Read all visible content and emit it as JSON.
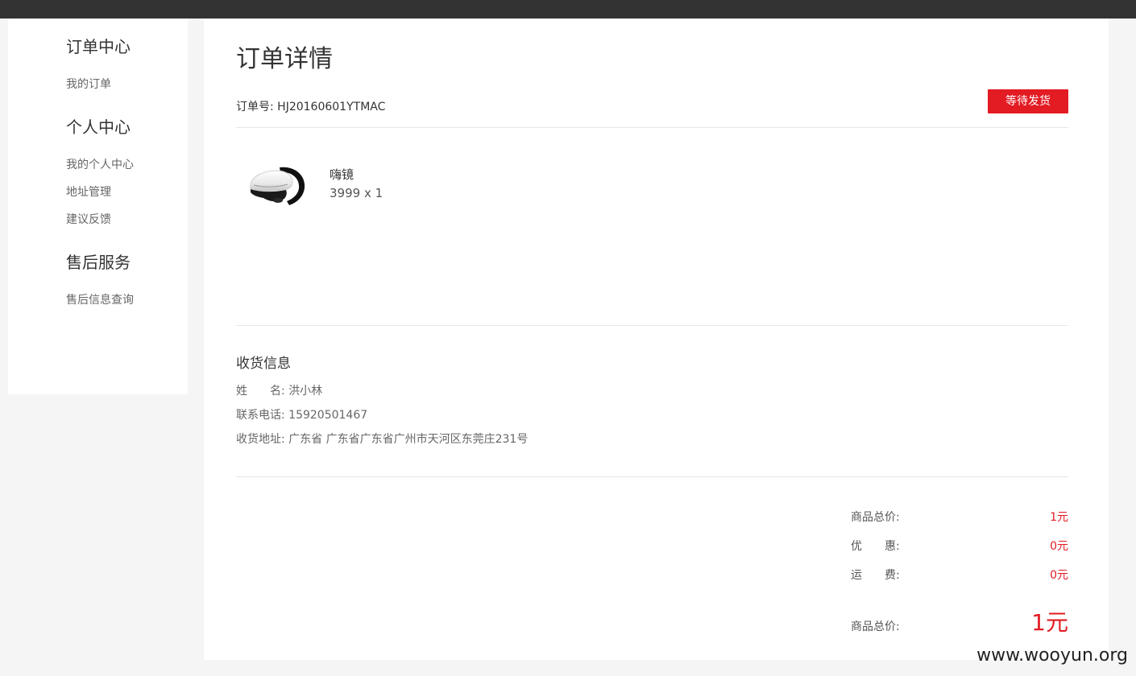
{
  "sidebar": {
    "sections": [
      {
        "heading": "订单中心",
        "items": [
          "我的订单"
        ]
      },
      {
        "heading": "个人中心",
        "items": [
          "我的个人中心",
          "地址管理",
          "建议反馈"
        ]
      },
      {
        "heading": "售后服务",
        "items": [
          "售后信息查询"
        ]
      }
    ]
  },
  "order": {
    "title": "订单详情",
    "number_label": "订单号:",
    "number": "HJ20160601YTMAC",
    "status": "等待发货",
    "status_color": "#e31b23"
  },
  "product": {
    "image_icon": "vr-headset-icon",
    "name": "嗨镜",
    "price_qty": "3999 x 1"
  },
  "shipping": {
    "title": "收货信息",
    "name_label": "姓　　名:",
    "name": "洪小林",
    "phone_label": "联系电话:",
    "phone": "15920501467",
    "address_label": "收货地址:",
    "address": "广东省 广东省广东省广州市天河区东莞庄231号"
  },
  "summary": {
    "subtotal_label": "商品总价:",
    "subtotal": "1元",
    "discount_label": "优　　惠:",
    "discount": "0元",
    "shipping_label": "运　　费:",
    "shipping": "0元",
    "total_label": "商品总价:",
    "total": "1元"
  },
  "watermark": "www.wooyun.org",
  "colors": {
    "accent": "#e31b23",
    "topbar": "#333333",
    "background": "#f5f5f5"
  }
}
